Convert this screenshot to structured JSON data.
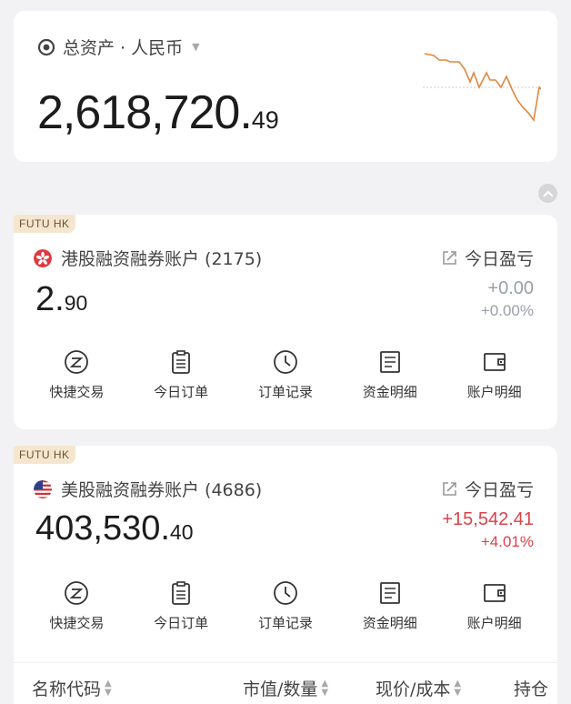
{
  "total": {
    "label": "总资产 · 人民币",
    "value_int": "2,618,720.",
    "value_dec": "49"
  },
  "accounts": [
    {
      "broker_tag": "FUTU HK",
      "title": "港股融资融券账户 (2175)",
      "pnl_label": "今日盈亏",
      "value_int": "2.",
      "value_dec": "90",
      "pnl_abs": "+0.00",
      "pnl_pct": "+0.00%"
    },
    {
      "broker_tag": "FUTU HK",
      "title": "美股融资融券账户 (4686)",
      "pnl_label": "今日盈亏",
      "value_int": "403,530.",
      "value_dec": "40",
      "pnl_abs": "+15,542.41",
      "pnl_pct": "+4.01%"
    }
  ],
  "actions": [
    "快捷交易",
    "今日订单",
    "订单记录",
    "资金明细",
    "账户明细"
  ],
  "table_headers": [
    "名称代码",
    "市值/数量",
    "现价/成本",
    "持仓"
  ],
  "colors": {
    "up": "#d8434a",
    "neutral": "#9aa0a8",
    "tag_bg": "#f5e6cf",
    "sparkline": "#e0873e"
  },
  "icons": {
    "total": "eye-icon",
    "hk_flag": "hong-kong-flag-icon",
    "us_flag": "us-flag-icon",
    "pnl": "share-icon",
    "actions": [
      "quick-trade-icon",
      "clipboard-icon",
      "clock-icon",
      "document-icon",
      "wallet-icon"
    ]
  }
}
